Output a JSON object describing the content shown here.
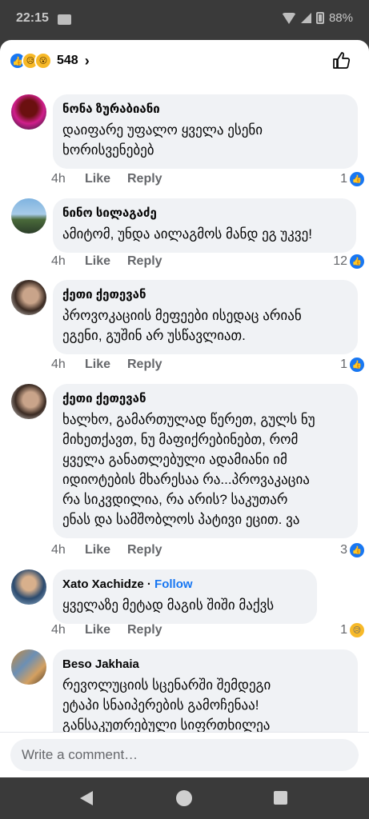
{
  "status": {
    "time": "22:15",
    "battery": "88%"
  },
  "header": {
    "reaction_count": "548"
  },
  "comments": [
    {
      "author": "ნონა ზურაბიანი",
      "text": "დაიფარე უფალო ყველა ესენი\nხორისვენებებ",
      "time": "4h",
      "like": "Like",
      "reply": "Reply",
      "reactions": "1"
    },
    {
      "author": "ნინო სილაგაძე",
      "text": "ამიტომ, უნდა აილაგმოს მანდ ეგ უკვე!",
      "time": "4h",
      "like": "Like",
      "reply": "Reply",
      "reactions": "12"
    },
    {
      "author": "ქეთი ქეთევან",
      "text": "პროვოკაციის მეფეები ისედაც არიან\nეგენი, გუშინ არ უსწავლიათ.",
      "time": "4h",
      "like": "Like",
      "reply": "Reply",
      "reactions": "1"
    },
    {
      "author": "ქეთი ქეთევან",
      "text": "ხალხო, გამართულად წერეთ, გულს ნუ\nმიხეთქავთ, ნუ მაფიქრებინებთ, რომ\nყველა განათლებული ადამიანი იმ\nიდიოტების მხარესაა რა...პროვაკაცია\nრა სიკვდილია, რა არის? საკუთარ\nენას და სამშობლოს პატივი ეცით. ვა",
      "time": "4h",
      "like": "Like",
      "reply": "Reply",
      "reactions": "3"
    },
    {
      "author": "Xato Xachidze",
      "follow": "Follow",
      "text": "ყველაზე მეტად მაგის შიში მაქვს",
      "time": "4h",
      "like": "Like",
      "reply": "Reply",
      "reactions": "1"
    },
    {
      "author": "Beso Jakhaia",
      "text": "რევოლუციის სცენარში შემდეგი\nეტაპი სნაიპერების გამოჩენაა!\nგანსაკუთრებული სიფრთხილეა"
    }
  ],
  "composer": {
    "placeholder": "Write a comment…"
  }
}
